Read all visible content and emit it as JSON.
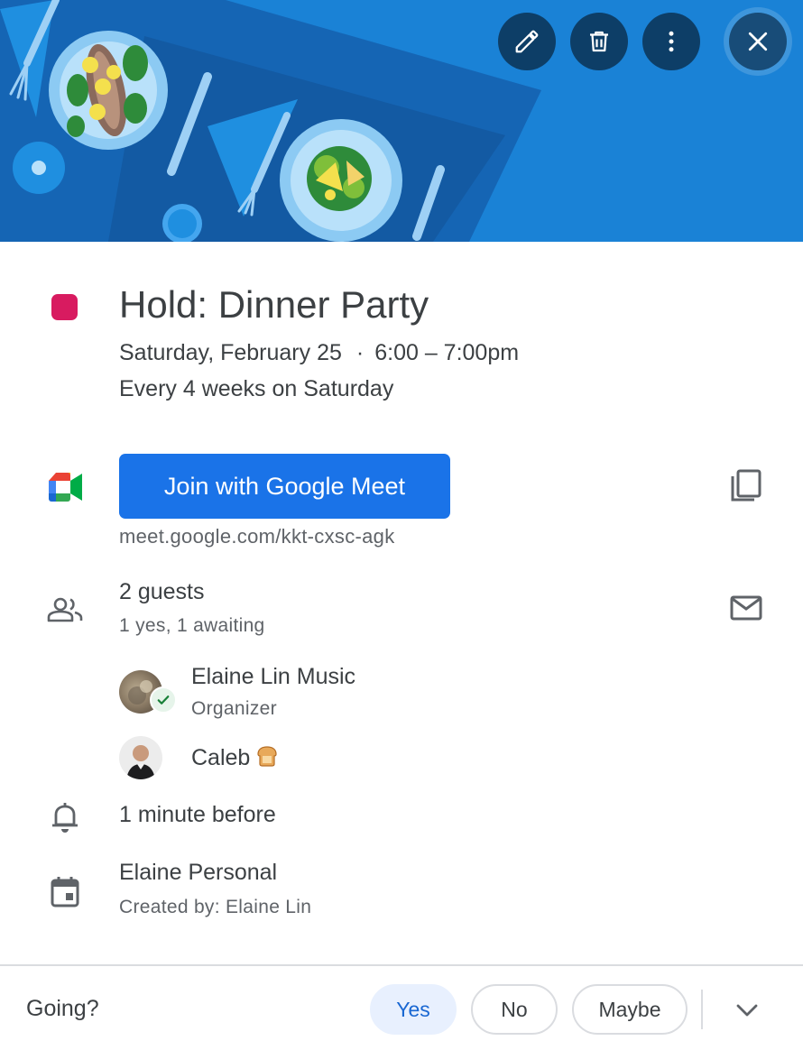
{
  "header": {
    "edit_icon": "pencil-icon",
    "delete_icon": "trash-icon",
    "options_icon": "more-vert-icon",
    "close_icon": "close-icon",
    "banner_color": "#1a82d6"
  },
  "event": {
    "title": "Hold: Dinner Party",
    "date": "Saturday, February 25",
    "separator": "·",
    "time": "6:00 – 7:00pm",
    "recurrence": "Every 4 weeks on Saturday",
    "color": "#d81b60"
  },
  "meet": {
    "join_label": "Join with Google Meet",
    "link": "meet.google.com/kkt-cxsc-agk",
    "button_color": "#1a73e8"
  },
  "guests": {
    "count_label": "2 guests",
    "summary": "1 yes, 1 awaiting",
    "list": [
      {
        "name": "Elaine Lin Music",
        "role": "Organizer",
        "status": "yes"
      },
      {
        "name": "Caleb",
        "role": "",
        "status": "awaiting"
      }
    ]
  },
  "reminder": {
    "label": "1 minute before"
  },
  "calendar": {
    "name": "Elaine Personal",
    "creator": "Created by: Elaine Lin"
  },
  "rsvp": {
    "prompt": "Going?",
    "options": [
      "Yes",
      "No",
      "Maybe"
    ],
    "selected": "Yes"
  }
}
